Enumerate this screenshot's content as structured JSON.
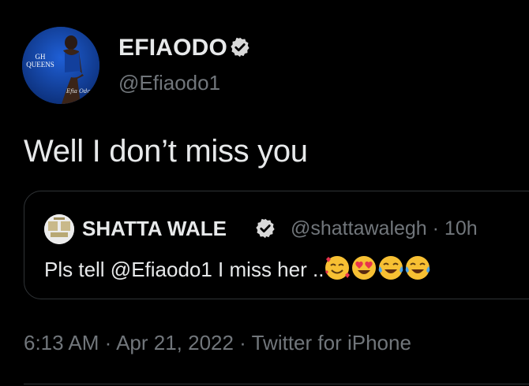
{
  "author": {
    "name": "EFIAODO",
    "handle": "@Efiaodo1",
    "avatar_text": "GH QUEENS",
    "avatar_signature": "Efia Odo"
  },
  "tweet": {
    "text": "Well I don’t miss you"
  },
  "quoted": {
    "name": "SHATTA WALE",
    "handle": "@shattawalegh · 10h",
    "text": "Pls tell @Efiaodo1 I miss her ..",
    "emojis": [
      "smiling-face-with-hearts",
      "heart-eyes",
      "tears-of-joy",
      "tears-of-joy"
    ]
  },
  "meta": {
    "timestamp": "6:13 AM · Apr 21, 2022 · Twitter for iPhone"
  },
  "colors": {
    "background": "#000000",
    "text": "#e7e9ea",
    "secondary": "#71767b",
    "border": "#2f3336",
    "verified_badge": "#d9d9d9"
  }
}
